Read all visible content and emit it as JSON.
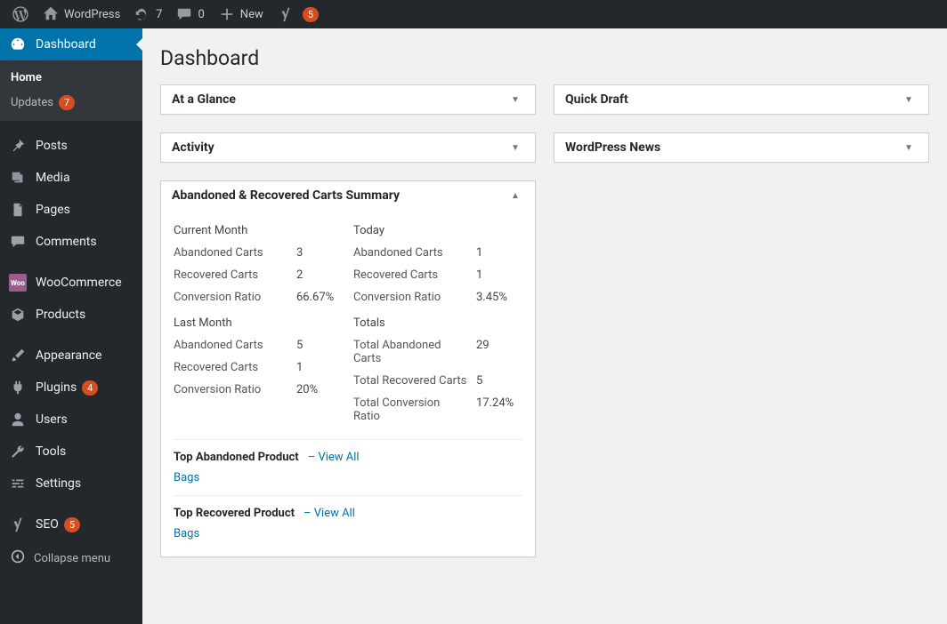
{
  "adminbar": {
    "site_name": "WordPress",
    "refresh_count": "7",
    "comments_count": "0",
    "new_label": "New",
    "yoast_badge": "5"
  },
  "sidebar": {
    "items": [
      {
        "label": "Dashboard"
      },
      {
        "label": "Posts"
      },
      {
        "label": "Media"
      },
      {
        "label": "Pages"
      },
      {
        "label": "Comments"
      },
      {
        "label": "WooCommerce"
      },
      {
        "label": "Products"
      },
      {
        "label": "Appearance"
      },
      {
        "label": "Plugins",
        "badge": "4"
      },
      {
        "label": "Users"
      },
      {
        "label": "Tools"
      },
      {
        "label": "Settings"
      },
      {
        "label": "SEO",
        "badge": "5"
      }
    ],
    "submenu_home": "Home",
    "submenu_updates": "Updates",
    "submenu_updates_badge": "7",
    "collapse_label": "Collapse menu"
  },
  "page": {
    "title": "Dashboard"
  },
  "widgets": {
    "glance": {
      "title": "At a Glance"
    },
    "activity": {
      "title": "Activity"
    },
    "quickdraft": {
      "title": "Quick Draft"
    },
    "news": {
      "title": "WordPress News"
    },
    "carts": {
      "title": "Abandoned & Recovered Carts Summary",
      "cm_title": "Current Month",
      "today_title": "Today",
      "lm_title": "Last Month",
      "totals_title": "Totals",
      "labels": {
        "abandoned": "Abandoned Carts",
        "recovered": "Recovered Carts",
        "ratio": "Conversion Ratio",
        "t_abandoned": "Total Abandoned Carts",
        "t_recovered": "Total Recovered Carts",
        "t_ratio": "Total Conversion Ratio"
      },
      "cm": {
        "abandoned": "3",
        "recovered": "2",
        "ratio": "66.67%"
      },
      "today": {
        "abandoned": "1",
        "recovered": "1",
        "ratio": "3.45%"
      },
      "lm": {
        "abandoned": "5",
        "recovered": "1",
        "ratio": "20%"
      },
      "totals": {
        "abandoned": "29",
        "recovered": "5",
        "ratio": "17.24%"
      },
      "top_abandoned_title": "Top Abandoned Product",
      "top_recovered_title": "Top Recovered Product",
      "view_all": "– View All",
      "top_abandoned_item": "Bags",
      "top_recovered_item": "Bags"
    }
  }
}
